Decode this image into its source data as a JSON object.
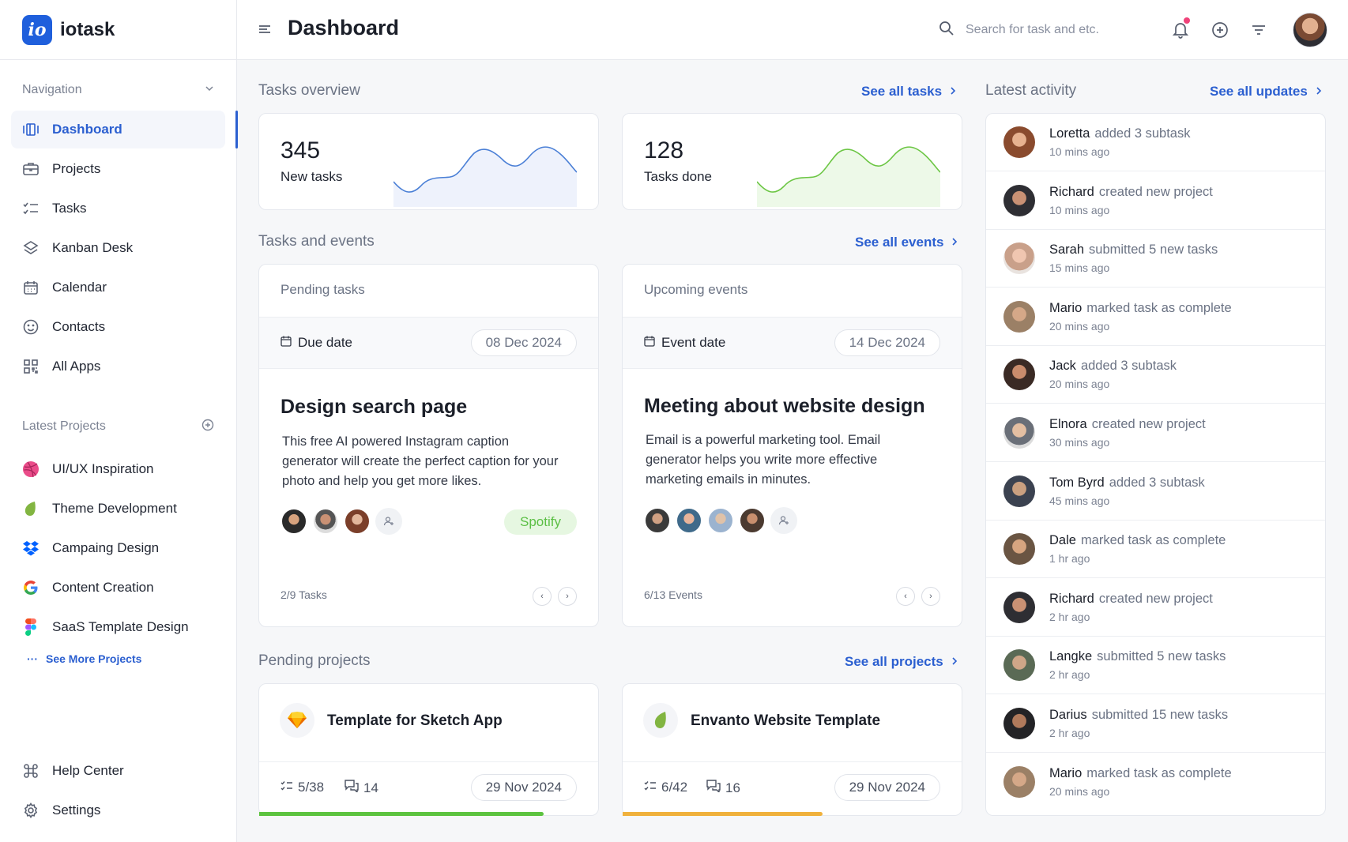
{
  "brand": {
    "logo_text": "io",
    "name": "iotask"
  },
  "sidebar": {
    "nav_heading": "Navigation",
    "nav_items": [
      {
        "label": "Dashboard",
        "icon": "dashboard-icon",
        "active": true
      },
      {
        "label": "Projects",
        "icon": "briefcase-icon"
      },
      {
        "label": "Tasks",
        "icon": "checklist-icon"
      },
      {
        "label": "Kanban Desk",
        "icon": "layers-icon"
      },
      {
        "label": "Calendar",
        "icon": "calendar-icon"
      },
      {
        "label": "Contacts",
        "icon": "smiley-icon"
      },
      {
        "label": "All Apps",
        "icon": "apps-grid-icon"
      }
    ],
    "projects_heading": "Latest Projects",
    "projects": [
      {
        "label": "UI/UX Inspiration",
        "icon": "dribbble-icon",
        "color": "#ea4c89"
      },
      {
        "label": "Theme Development",
        "icon": "envato-leaf-icon",
        "color": "#82b541"
      },
      {
        "label": "Campaing Design",
        "icon": "dropbox-icon",
        "color": "#0061ff"
      },
      {
        "label": "Content Creation",
        "icon": "google-icon",
        "color": "#4285f4"
      },
      {
        "label": "SaaS Template Design",
        "icon": "figma-icon",
        "color": "#f24e1e"
      }
    ],
    "see_more": "See More Projects",
    "bottom_items": [
      {
        "label": "Help Center",
        "icon": "command-icon"
      },
      {
        "label": "Settings",
        "icon": "gear-icon"
      }
    ]
  },
  "topbar": {
    "title": "Dashboard",
    "search_placeholder": "Search for task and etc."
  },
  "overview": {
    "title": "Tasks overview",
    "link": "See all tasks",
    "stats": [
      {
        "value": "345",
        "label": "New tasks",
        "color": "#4a7fd6"
      },
      {
        "value": "128",
        "label": "Tasks done",
        "color": "#6cc644"
      }
    ]
  },
  "events": {
    "title": "Tasks and events",
    "link": "See all events",
    "pending": {
      "heading": "Pending tasks",
      "date_label": "Due date",
      "date": "08 Dec 2024",
      "title": "Design search page",
      "desc": "This free AI powered Instagram caption generator will create the perfect caption for your photo and help you get more likes.",
      "tag": "Spotify",
      "count": "2/9 Tasks"
    },
    "upcoming": {
      "heading": "Upcoming events",
      "date_label": "Event date",
      "date": "14 Dec 2024",
      "title": "Meeting about website design",
      "desc": "Email is a powerful marketing tool. Email generator helps you write more effective marketing emails in minutes.",
      "count": "6/13 Events"
    }
  },
  "projects": {
    "title": "Pending projects",
    "link": "See all projects",
    "items": [
      {
        "name": "Template for Sketch App",
        "icon": "sketch-icon",
        "tasks": "5/38",
        "comments": "14",
        "date": "29 Nov 2024",
        "progress": 0.84,
        "color": "#5cc33f"
      },
      {
        "name": "Envanto Website Template",
        "icon": "envato-leaf-icon",
        "tasks": "6/42",
        "comments": "16",
        "date": "29 Nov 2024",
        "progress": 0.59,
        "color": "#f0b13c"
      }
    ]
  },
  "activity": {
    "title": "Latest activity",
    "link": "See all updates",
    "items": [
      {
        "name": "Loretta",
        "action": "added 3 subtask",
        "time": "10 mins ago"
      },
      {
        "name": "Richard",
        "action": "created new project",
        "time": "10 mins ago"
      },
      {
        "name": "Sarah",
        "action": "submitted 5 new tasks",
        "time": "15 mins ago"
      },
      {
        "name": "Mario",
        "action": "marked task as complete",
        "time": "20 mins ago"
      },
      {
        "name": "Jack",
        "action": "added 3 subtask",
        "time": "20 mins ago"
      },
      {
        "name": "Elnora",
        "action": "created new project",
        "time": "30 mins ago"
      },
      {
        "name": "Tom Byrd",
        "action": "added 3 subtask",
        "time": "45 mins ago"
      },
      {
        "name": "Dale",
        "action": "marked task as complete",
        "time": "1 hr ago"
      },
      {
        "name": "Richard",
        "action": "created new project",
        "time": "2 hr ago"
      },
      {
        "name": "Langke",
        "action": "submitted 5 new tasks",
        "time": "2 hr ago"
      },
      {
        "name": "Darius",
        "action": "submitted 15 new tasks",
        "time": "2 hr ago"
      },
      {
        "name": "Mario",
        "action": "marked task as complete",
        "time": "20 mins ago"
      }
    ]
  }
}
